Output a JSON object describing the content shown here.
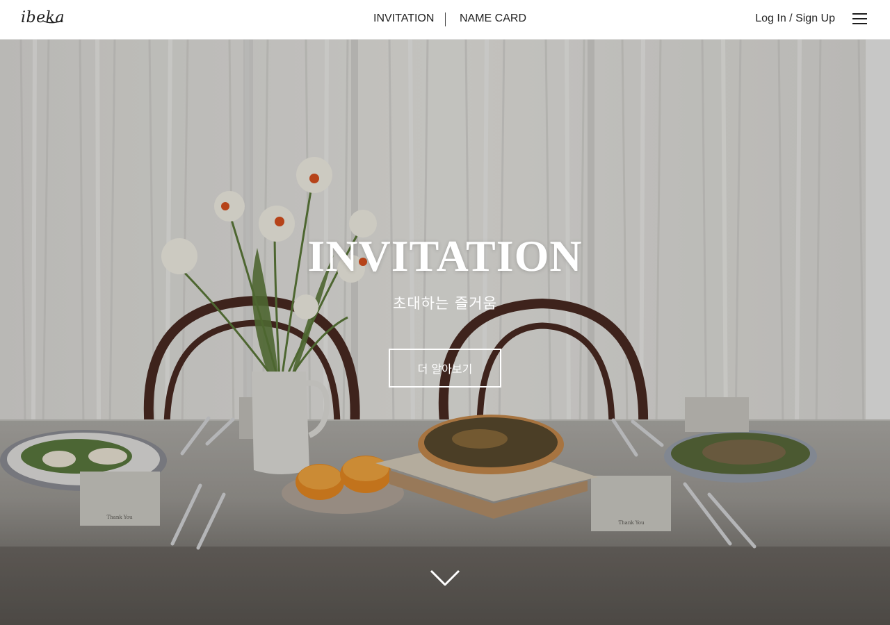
{
  "header": {
    "logo": "ibeka",
    "nav": [
      {
        "label": "INVITATION"
      },
      {
        "label": "NAME CARD"
      }
    ],
    "auth_label": "Log In / Sign Up",
    "menu_icon": "hamburger-menu-icon"
  },
  "hero": {
    "title": "INVITATION",
    "subtitle": "초대하는 즐거움",
    "button_label": "더 알아보기",
    "scroll_icon": "chevron-down-icon",
    "place_card_text": "Thank You"
  },
  "colors": {
    "header_bg": "#ffffff",
    "text_dark": "#222222",
    "hero_text": "#ffffff",
    "curtain": "#e9e8e6",
    "tablecloth": "#8c8a86",
    "chair": "#4a2a22"
  }
}
